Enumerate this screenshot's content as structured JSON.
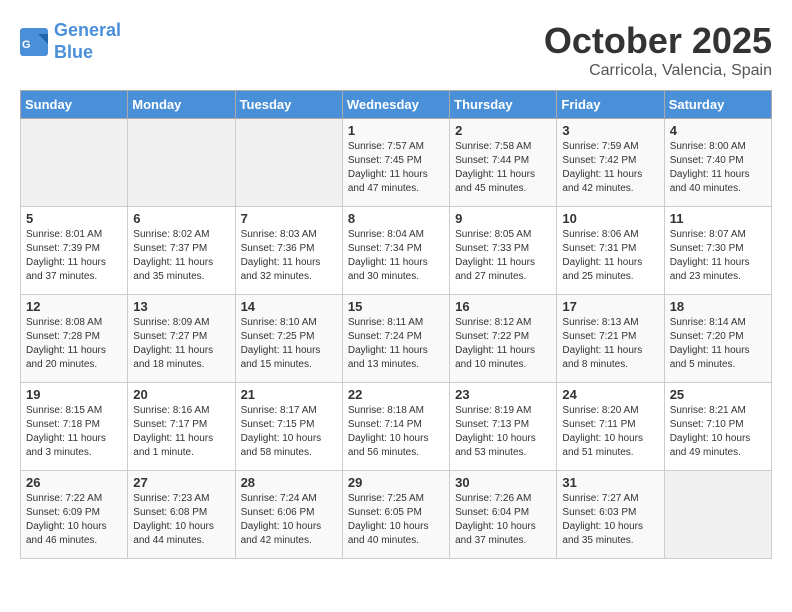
{
  "header": {
    "logo_line1": "General",
    "logo_line2": "Blue",
    "month": "October 2025",
    "location": "Carricola, Valencia, Spain"
  },
  "weekdays": [
    "Sunday",
    "Monday",
    "Tuesday",
    "Wednesday",
    "Thursday",
    "Friday",
    "Saturday"
  ],
  "weeks": [
    [
      {
        "day": "",
        "info": ""
      },
      {
        "day": "",
        "info": ""
      },
      {
        "day": "",
        "info": ""
      },
      {
        "day": "1",
        "info": "Sunrise: 7:57 AM\nSunset: 7:45 PM\nDaylight: 11 hours and 47 minutes."
      },
      {
        "day": "2",
        "info": "Sunrise: 7:58 AM\nSunset: 7:44 PM\nDaylight: 11 hours and 45 minutes."
      },
      {
        "day": "3",
        "info": "Sunrise: 7:59 AM\nSunset: 7:42 PM\nDaylight: 11 hours and 42 minutes."
      },
      {
        "day": "4",
        "info": "Sunrise: 8:00 AM\nSunset: 7:40 PM\nDaylight: 11 hours and 40 minutes."
      }
    ],
    [
      {
        "day": "5",
        "info": "Sunrise: 8:01 AM\nSunset: 7:39 PM\nDaylight: 11 hours and 37 minutes."
      },
      {
        "day": "6",
        "info": "Sunrise: 8:02 AM\nSunset: 7:37 PM\nDaylight: 11 hours and 35 minutes."
      },
      {
        "day": "7",
        "info": "Sunrise: 8:03 AM\nSunset: 7:36 PM\nDaylight: 11 hours and 32 minutes."
      },
      {
        "day": "8",
        "info": "Sunrise: 8:04 AM\nSunset: 7:34 PM\nDaylight: 11 hours and 30 minutes."
      },
      {
        "day": "9",
        "info": "Sunrise: 8:05 AM\nSunset: 7:33 PM\nDaylight: 11 hours and 27 minutes."
      },
      {
        "day": "10",
        "info": "Sunrise: 8:06 AM\nSunset: 7:31 PM\nDaylight: 11 hours and 25 minutes."
      },
      {
        "day": "11",
        "info": "Sunrise: 8:07 AM\nSunset: 7:30 PM\nDaylight: 11 hours and 23 minutes."
      }
    ],
    [
      {
        "day": "12",
        "info": "Sunrise: 8:08 AM\nSunset: 7:28 PM\nDaylight: 11 hours and 20 minutes."
      },
      {
        "day": "13",
        "info": "Sunrise: 8:09 AM\nSunset: 7:27 PM\nDaylight: 11 hours and 18 minutes."
      },
      {
        "day": "14",
        "info": "Sunrise: 8:10 AM\nSunset: 7:25 PM\nDaylight: 11 hours and 15 minutes."
      },
      {
        "day": "15",
        "info": "Sunrise: 8:11 AM\nSunset: 7:24 PM\nDaylight: 11 hours and 13 minutes."
      },
      {
        "day": "16",
        "info": "Sunrise: 8:12 AM\nSunset: 7:22 PM\nDaylight: 11 hours and 10 minutes."
      },
      {
        "day": "17",
        "info": "Sunrise: 8:13 AM\nSunset: 7:21 PM\nDaylight: 11 hours and 8 minutes."
      },
      {
        "day": "18",
        "info": "Sunrise: 8:14 AM\nSunset: 7:20 PM\nDaylight: 11 hours and 5 minutes."
      }
    ],
    [
      {
        "day": "19",
        "info": "Sunrise: 8:15 AM\nSunset: 7:18 PM\nDaylight: 11 hours and 3 minutes."
      },
      {
        "day": "20",
        "info": "Sunrise: 8:16 AM\nSunset: 7:17 PM\nDaylight: 11 hours and 1 minute."
      },
      {
        "day": "21",
        "info": "Sunrise: 8:17 AM\nSunset: 7:15 PM\nDaylight: 10 hours and 58 minutes."
      },
      {
        "day": "22",
        "info": "Sunrise: 8:18 AM\nSunset: 7:14 PM\nDaylight: 10 hours and 56 minutes."
      },
      {
        "day": "23",
        "info": "Sunrise: 8:19 AM\nSunset: 7:13 PM\nDaylight: 10 hours and 53 minutes."
      },
      {
        "day": "24",
        "info": "Sunrise: 8:20 AM\nSunset: 7:11 PM\nDaylight: 10 hours and 51 minutes."
      },
      {
        "day": "25",
        "info": "Sunrise: 8:21 AM\nSunset: 7:10 PM\nDaylight: 10 hours and 49 minutes."
      }
    ],
    [
      {
        "day": "26",
        "info": "Sunrise: 7:22 AM\nSunset: 6:09 PM\nDaylight: 10 hours and 46 minutes."
      },
      {
        "day": "27",
        "info": "Sunrise: 7:23 AM\nSunset: 6:08 PM\nDaylight: 10 hours and 44 minutes."
      },
      {
        "day": "28",
        "info": "Sunrise: 7:24 AM\nSunset: 6:06 PM\nDaylight: 10 hours and 42 minutes."
      },
      {
        "day": "29",
        "info": "Sunrise: 7:25 AM\nSunset: 6:05 PM\nDaylight: 10 hours and 40 minutes."
      },
      {
        "day": "30",
        "info": "Sunrise: 7:26 AM\nSunset: 6:04 PM\nDaylight: 10 hours and 37 minutes."
      },
      {
        "day": "31",
        "info": "Sunrise: 7:27 AM\nSunset: 6:03 PM\nDaylight: 10 hours and 35 minutes."
      },
      {
        "day": "",
        "info": ""
      }
    ]
  ]
}
